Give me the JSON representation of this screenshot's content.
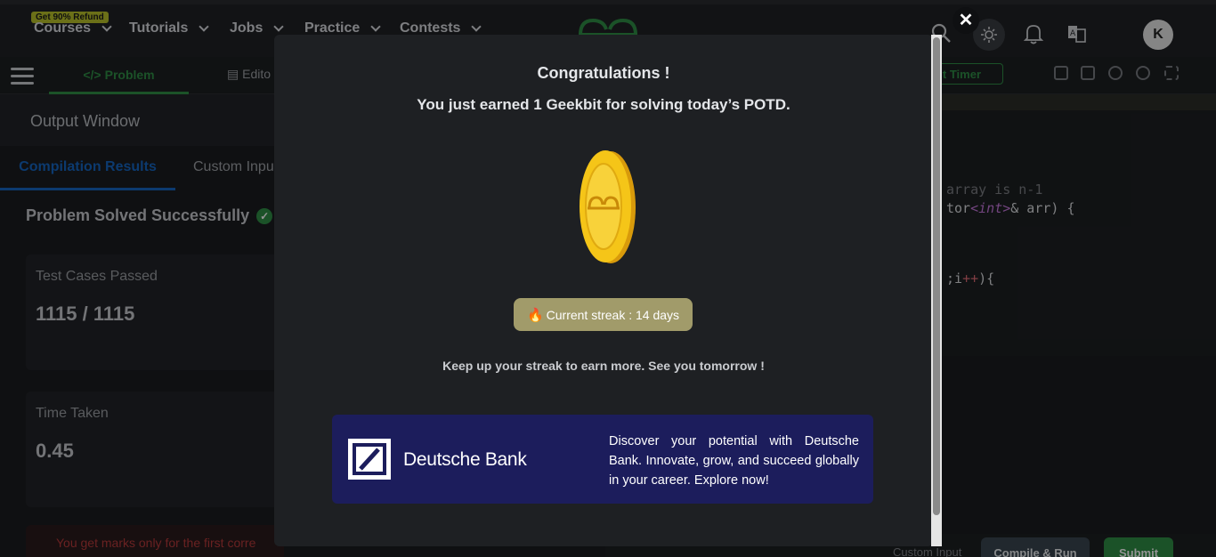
{
  "topnav": {
    "refund_badge": "Get 90% Refund",
    "items": [
      {
        "label": "Courses"
      },
      {
        "label": "Tutorials"
      },
      {
        "label": "Jobs"
      },
      {
        "label": "Practice"
      },
      {
        "label": "Contests"
      }
    ],
    "avatar_initial": "K",
    "icons": [
      "search-icon",
      "theme-toggle-icon",
      "bell-icon",
      "translate-icon"
    ]
  },
  "subbar": {
    "problem_tab": "Problem",
    "editorial_tab": "Edito",
    "timer_btn": "t Timer"
  },
  "output": {
    "title": "Output Window",
    "tabs": [
      {
        "label": "Compilation Results"
      },
      {
        "label": "Custom Inpu"
      }
    ],
    "status": "Problem Solved Successfully",
    "test_cases_label": "Test Cases Passed",
    "test_cases_value": "1115 / 1115",
    "time_label": "Time Taken",
    "time_value": "0.45",
    "marks_note": "You get marks only for the first corre"
  },
  "editor": {
    "line1_comment": "array is n-1",
    "line2_a": "tor",
    "line2_kw": "<int>",
    "line2_b": "& arr) {",
    "line3_a": ";i",
    "line3_op": "++",
    "line3_b": "){"
  },
  "bottom": {
    "custom_input": "Custom Input",
    "compile": "Compile & Run",
    "submit": "Submit"
  },
  "modal": {
    "close": "✕",
    "title": "Congratulations !",
    "subtitle": "You just earned 1 Geekbit for solving today’s POTD.",
    "streak": "Current streak : 14 days",
    "keepup": "Keep up your streak to earn more. See you tomorrow !",
    "ad": {
      "brand": "Deutsche Bank",
      "text": "Discover your potential with Deutsche Bank. Innovate, grow, and succeed globally in your career. Explore now!"
    }
  },
  "colors": {
    "accent_green": "#2f8d46",
    "accent_blue": "#1565c0",
    "ad_background": "#1c1d5c",
    "streak_badge": "#a19b6a",
    "coin_gold": "#f5c518"
  }
}
